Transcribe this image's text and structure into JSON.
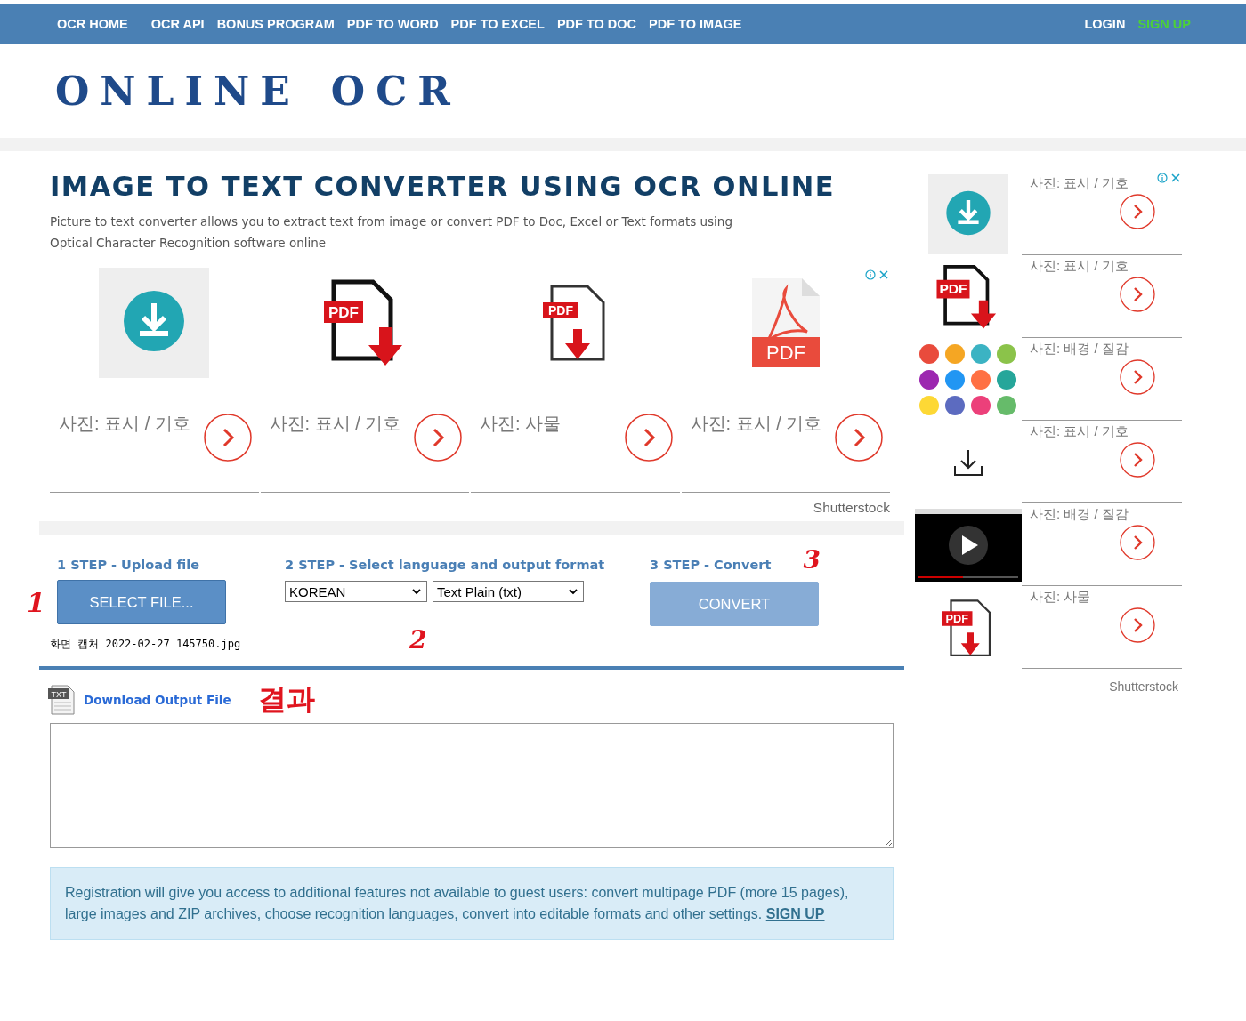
{
  "nav": {
    "items": [
      {
        "label": "OCR HOME"
      },
      {
        "label": "OCR API"
      },
      {
        "label": "BONUS PROGRAM"
      },
      {
        "label": "PDF TO WORD"
      },
      {
        "label": "PDF TO EXCEL"
      },
      {
        "label": "PDF TO DOC"
      },
      {
        "label": "PDF TO IMAGE"
      }
    ],
    "login": "LOGIN",
    "signup": "SIGN UP"
  },
  "logo": {
    "words": [
      "ONLINE",
      "OCR"
    ]
  },
  "title": "IMAGE TO TEXT CONVERTER USING OCR ONLINE",
  "description": "Picture to text converter allows you to extract text from image or convert PDF to Doc, Excel or Text formats using Optical Character Recognition software online",
  "ad_main": {
    "cards": [
      {
        "kind": "download-circle",
        "label": "사진: 표시 / 기호"
      },
      {
        "kind": "pdf-file",
        "badge": "PDF",
        "label": "사진: 표시 / 기호"
      },
      {
        "kind": "pdf-small",
        "badge": "PDF",
        "label": "사진: 사물"
      },
      {
        "kind": "acrobat",
        "badge": "PDF",
        "label": "사진: 표시 / 기호"
      }
    ],
    "credit": "Shutterstock"
  },
  "steps": [
    {
      "heading": "1 STEP - Upload file",
      "mark": "1"
    },
    {
      "heading": "2 STEP - Select language and output format",
      "mark": "2"
    },
    {
      "heading": "3 STEP - Convert",
      "mark": "3"
    }
  ],
  "select_button": "SELECT FILE...",
  "file_name": "화면 캡처 2022-02-27 145750.jpg",
  "language": "KOREAN",
  "format": "Text Plain (txt)",
  "convert_button": "CONVERT",
  "download": {
    "label": "Download Output File",
    "icon_text": "TXT",
    "mark": "결과"
  },
  "notice": {
    "text": "Registration will give you access to additional features not available to guest users: convert multipage PDF (more 15 pages), large images and ZIP archives, choose recognition languages, convert into editable formats and other settings.",
    "link": "SIGN UP"
  },
  "ad_side": {
    "items": [
      {
        "kind": "download-circle",
        "label": "사진: 표시 / 기호"
      },
      {
        "kind": "pdf-file",
        "badge": "PDF",
        "label": "사진: 표시 / 기호"
      },
      {
        "kind": "infographic",
        "label": "사진: 배경 / 질감"
      },
      {
        "kind": "download-line",
        "label": "사진: 표시 / 기호"
      },
      {
        "kind": "video",
        "label": "사진: 배경 / 질감"
      },
      {
        "kind": "pdf-small",
        "badge": "PDF",
        "label": "사진: 사물"
      }
    ],
    "credit": "Shutterstock"
  }
}
